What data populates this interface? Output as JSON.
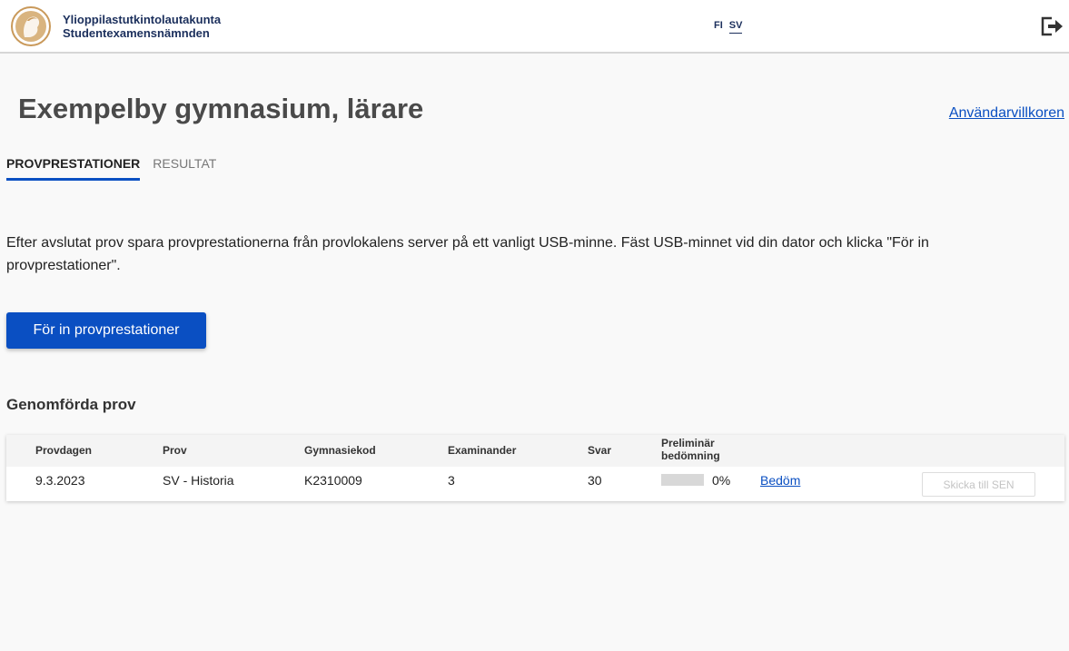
{
  "header": {
    "org_name_fi": "Ylioppilastutkintolautakunta",
    "org_name_sv": "Studentexamensnämnden",
    "languages": [
      "FI",
      "SV"
    ],
    "active_language": "SV",
    "logo_icon": "ytl-logo-icon",
    "logout_icon": "logout-icon"
  },
  "page": {
    "title": "Exempelby gymnasium, lärare",
    "terms_link": "Användarvillkoren"
  },
  "tabs": [
    {
      "label": "PROVPRESTATIONER",
      "active": true
    },
    {
      "label": "RESULTAT",
      "active": false
    }
  ],
  "instructions": "Efter avslutat prov spara provprestationerna från provlokalens server på ett vanligt USB-minne. Fäst USB-minnet vid din dator och klicka \"För in provprestationer\".",
  "import_button": "För in provprestationer",
  "section_heading": "Genomförda prov",
  "table": {
    "headers": {
      "date": "Provdagen",
      "exam": "Prov",
      "school_code": "Gymnasiekod",
      "examinees": "Examinander",
      "answers": "Svar",
      "preliminary_grading": "Preliminär bedömning"
    },
    "rows": [
      {
        "date": "9.3.2023",
        "exam": "SV - Historia",
        "school_code": "K2310009",
        "examinees": "3",
        "answers": "30",
        "grading_progress": 0,
        "grading_percent": "0%",
        "grade_link": "Bedöm",
        "send_button": "Skicka till SEN"
      }
    ]
  },
  "colors": {
    "accent": "#0a4fc2",
    "brand_text": "#1b2f5c",
    "logo_gold": "#c9995a"
  }
}
